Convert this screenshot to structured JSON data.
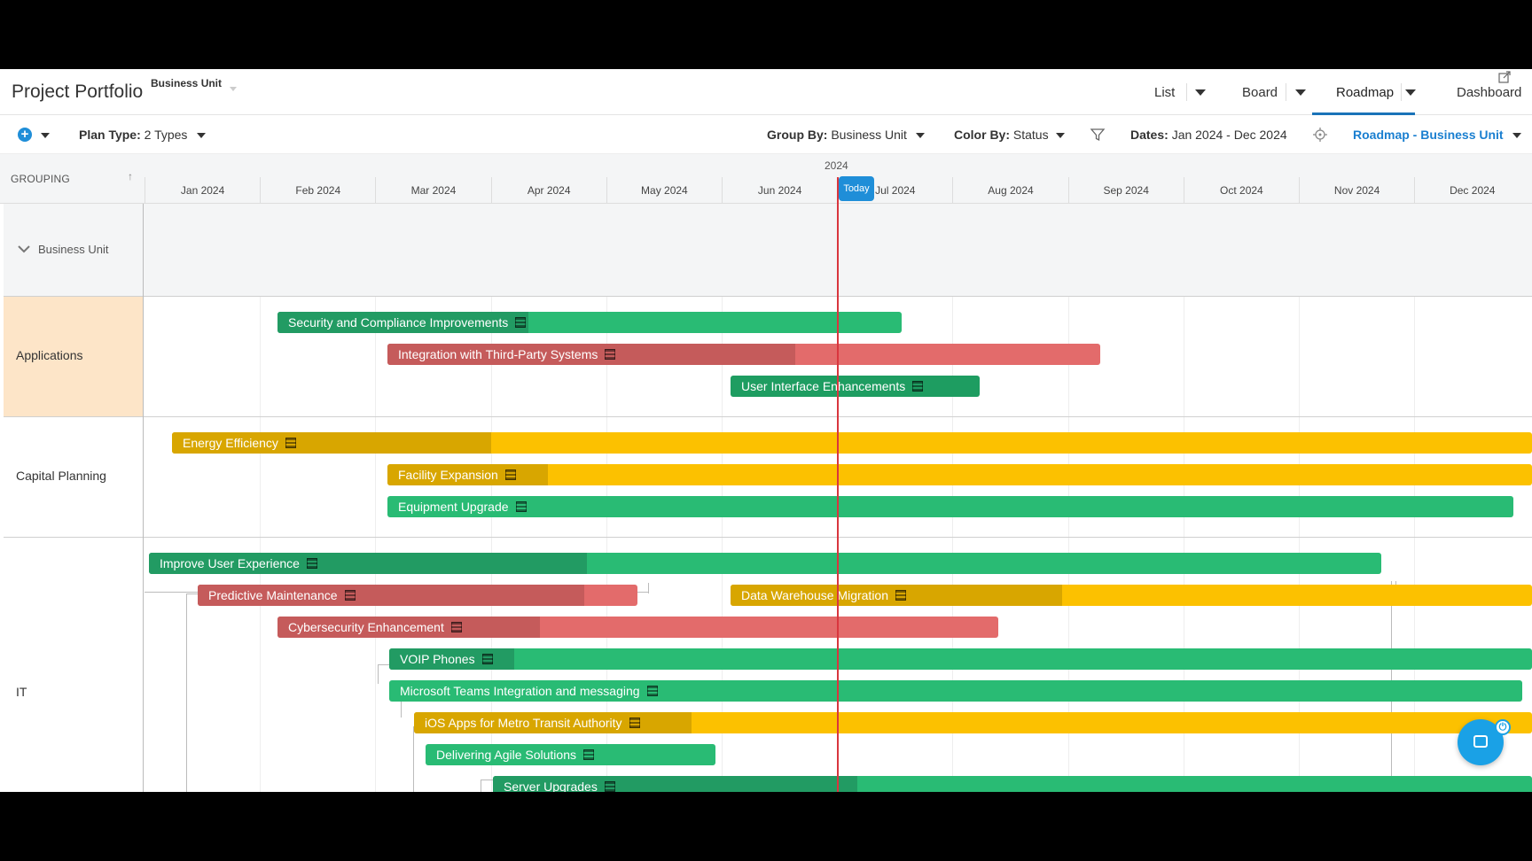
{
  "header": {
    "title": "Project Portfolio",
    "business_unit": "Business Unit",
    "nav": {
      "list": "List",
      "board": "Board",
      "roadmap": "Roadmap",
      "dashboard": "Dashboard",
      "active": "Roadmap"
    }
  },
  "toolbar": {
    "plan_type_label": "Plan Type:",
    "plan_type_value": "2 Types",
    "group_by_label": "Group By:",
    "group_by_value": "Business Unit",
    "color_by_label": "Color By:",
    "color_by_value": "Status",
    "dates_label": "Dates:",
    "dates_value": "Jan 2024 - Dec 2024",
    "view_name": "Roadmap - Business Unit"
  },
  "timeline": {
    "grouping_label": "GROUPING",
    "year": "2024",
    "months": [
      "Jan 2024",
      "Feb 2024",
      "Mar 2024",
      "Apr 2024",
      "May 2024",
      "Jun 2024",
      "Jul 2024",
      "Aug 2024",
      "Sep 2024",
      "Oct 2024",
      "Nov 2024",
      "Dec 2024"
    ],
    "today_label": "Today"
  },
  "groups": {
    "header": "Business Unit",
    "applications": "Applications",
    "capital_planning": "Capital Planning",
    "it": "IT"
  },
  "bars": {
    "security": "Security and Compliance Improvements",
    "integration": "Integration with Third-Party Systems",
    "ui": "User Interface Enhancements",
    "energy": "Energy Efficiency",
    "facility": "Facility Expansion",
    "equipment": "Equipment Upgrade",
    "ux": "Improve User Experience",
    "predictive": "Predictive Maintenance",
    "dw": "Data Warehouse Migration",
    "cyber": "Cybersecurity Enhancement",
    "voip": "VOIP Phones",
    "teams": "Microsoft Teams Integration and messaging",
    "ios": "iOS Apps for Metro Transit Authority",
    "agile": "Delivering Agile Solutions",
    "server": "Server Upgrades"
  },
  "colors": {
    "on_track": "#29bb74",
    "at_risk": "#fcc100",
    "off_track": "#e36b6b",
    "accent": "#1f8ed8",
    "today_line": "#d9363e"
  },
  "icons": [
    "plus-icon",
    "filter-icon",
    "crosshair-icon",
    "expand-icon",
    "task-list-icon",
    "bot-icon"
  ]
}
